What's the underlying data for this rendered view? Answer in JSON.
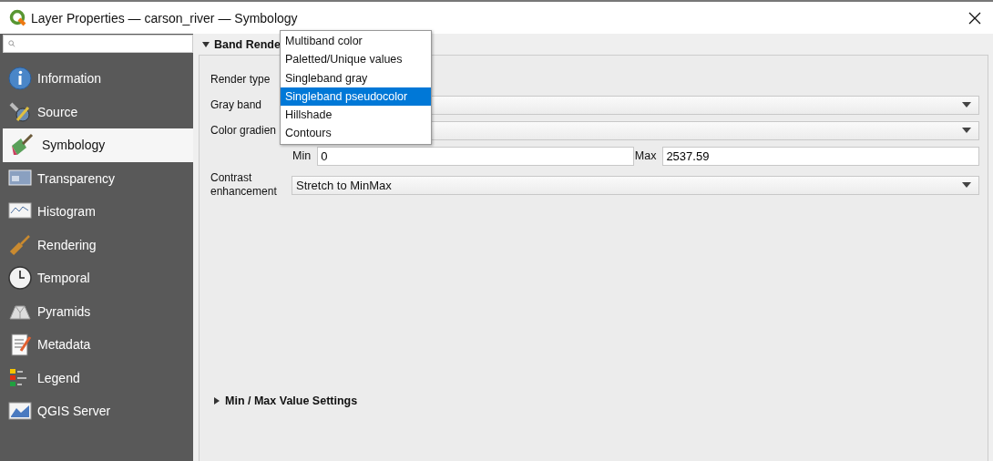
{
  "window": {
    "title": "Layer Properties — carson_river — Symbology"
  },
  "sidebar": {
    "items": [
      {
        "label": "Information",
        "selected": false
      },
      {
        "label": "Source",
        "selected": false
      },
      {
        "label": "Symbology",
        "selected": true
      },
      {
        "label": "Transparency",
        "selected": false
      },
      {
        "label": "Histogram",
        "selected": false
      },
      {
        "label": "Rendering",
        "selected": false
      },
      {
        "label": "Temporal",
        "selected": false
      },
      {
        "label": "Pyramids",
        "selected": false
      },
      {
        "label": "Metadata",
        "selected": false
      },
      {
        "label": "Legend",
        "selected": false
      },
      {
        "label": "QGIS Server",
        "selected": false
      }
    ]
  },
  "band_rendering": {
    "title": "Band Rende",
    "expanded": true,
    "render_type_label": "Render type",
    "gray_band_label": "Gray band",
    "color_gradient_label": "Color gradien",
    "min_label": "Min",
    "min_value": "0",
    "max_label": "Max",
    "max_value": "2537.59",
    "contrast_label": "Contrast enhancement",
    "contrast_value": "Stretch to MinMax"
  },
  "min_max_settings": {
    "title": "Min / Max Value Settings",
    "expanded": false
  },
  "render_type_dropdown": {
    "options": [
      {
        "label": "Multiband color",
        "selected": false
      },
      {
        "label": "Paletted/Unique values",
        "selected": false
      },
      {
        "label": "Singleband gray",
        "selected": false
      },
      {
        "label": "Singleband pseudocolor",
        "selected": true
      },
      {
        "label": "Hillshade",
        "selected": false
      },
      {
        "label": "Contours",
        "selected": false
      }
    ]
  }
}
